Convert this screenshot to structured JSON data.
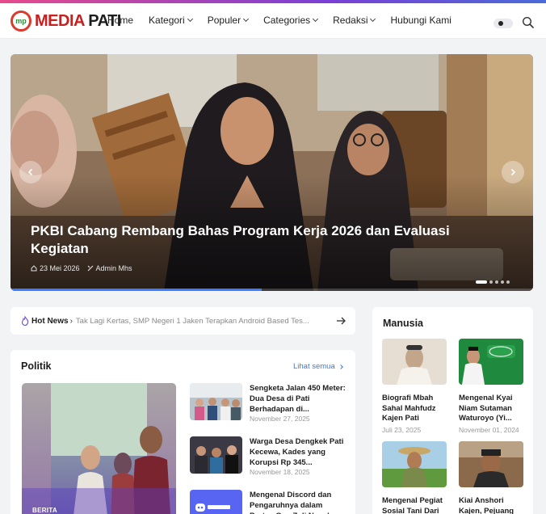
{
  "header": {
    "logo_badge": "mp",
    "logo_word_1": "MEDIA",
    "logo_word_2": "PATI",
    "nav": [
      "Home",
      "Kategori",
      "Populer",
      "Categories",
      "Redaksi",
      "Hubungi Kami"
    ],
    "nav_has_caret": [
      false,
      true,
      true,
      true,
      true,
      false
    ]
  },
  "hero": {
    "title": "PKBI Cabang Rembang Bahas Program Kerja 2026 dan Evaluasi Kegiatan",
    "date": "23 Mei 2026",
    "author": "Admin Mhs",
    "slides_total": 5,
    "active_slide": 1,
    "progress": 0.48
  },
  "hotnews": {
    "label": "Hot News",
    "text": "Tak Lagi Kertas, SMP Negeri 1 Jaken Terapkan Android Based Tes..."
  },
  "politik": {
    "title": "Politik",
    "see_all": "Lihat semua",
    "feature_badge": "BERITA",
    "items": [
      {
        "title": "Sengketa Jalan 450 Meter: Dua Desa di Pati Berhadapan di...",
        "date": "November 27, 2025"
      },
      {
        "title": "Warga Desa Dengkek Pati Kecewa, Kades yang Korupsi Rp 345...",
        "date": "November 18, 2025"
      },
      {
        "title": "Mengenal Discord dan Pengaruhnya dalam Protes Gen Z di Nepal",
        "date": ""
      }
    ]
  },
  "manusia": {
    "title": "Manusia",
    "items": [
      {
        "title": "Biografi Mbah Sahal Mahfudz Kajen Pati",
        "date": "Juli 23, 2025"
      },
      {
        "title": "Mengenal Kyai Niam Sutaman Waturoyo (Yi...",
        "date": "November 01, 2024"
      },
      {
        "title": "Mengenal Pegiat Sosial Tani Dari Kajen",
        "date": ""
      },
      {
        "title": "Kiai Anshori Kajen, Pejuang Pendidikan",
        "date": ""
      }
    ]
  },
  "colors": {
    "accent": "#3f78d8",
    "brand_red": "#c62020",
    "progress": "#3a7bff"
  }
}
